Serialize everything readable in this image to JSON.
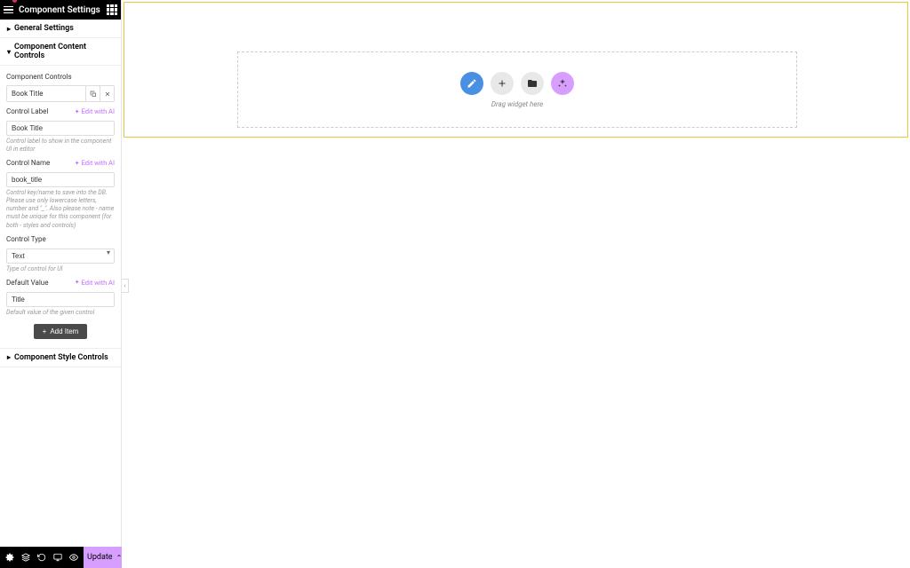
{
  "header": {
    "title": "Component Settings"
  },
  "sections": {
    "general": "General Settings",
    "content": "Component Content Controls",
    "style": "Component Style Controls"
  },
  "controls_header": "Component Controls",
  "item": {
    "title": "Book Title"
  },
  "fields": {
    "label": {
      "label": "Control Label",
      "value": "Book Title",
      "help": "Control label to show in the component UI in editor"
    },
    "name": {
      "label": "Control Name",
      "value": "book_title",
      "help": "Control key/name to save into the DB. Please use only lowercase letters, number and \"_\". Also please note - name must be unique for this component (for both - styles and controls)"
    },
    "type": {
      "label": "Control Type",
      "value": "Text",
      "help": "Type of control for UI"
    },
    "default": {
      "label": "Default Value",
      "value": "Title",
      "help": "Default value of the given control"
    }
  },
  "edit_ai": "Edit with AI",
  "add_item": "Add Item",
  "footer": {
    "update": "Update"
  },
  "drop": {
    "text": "Drag widget here"
  }
}
